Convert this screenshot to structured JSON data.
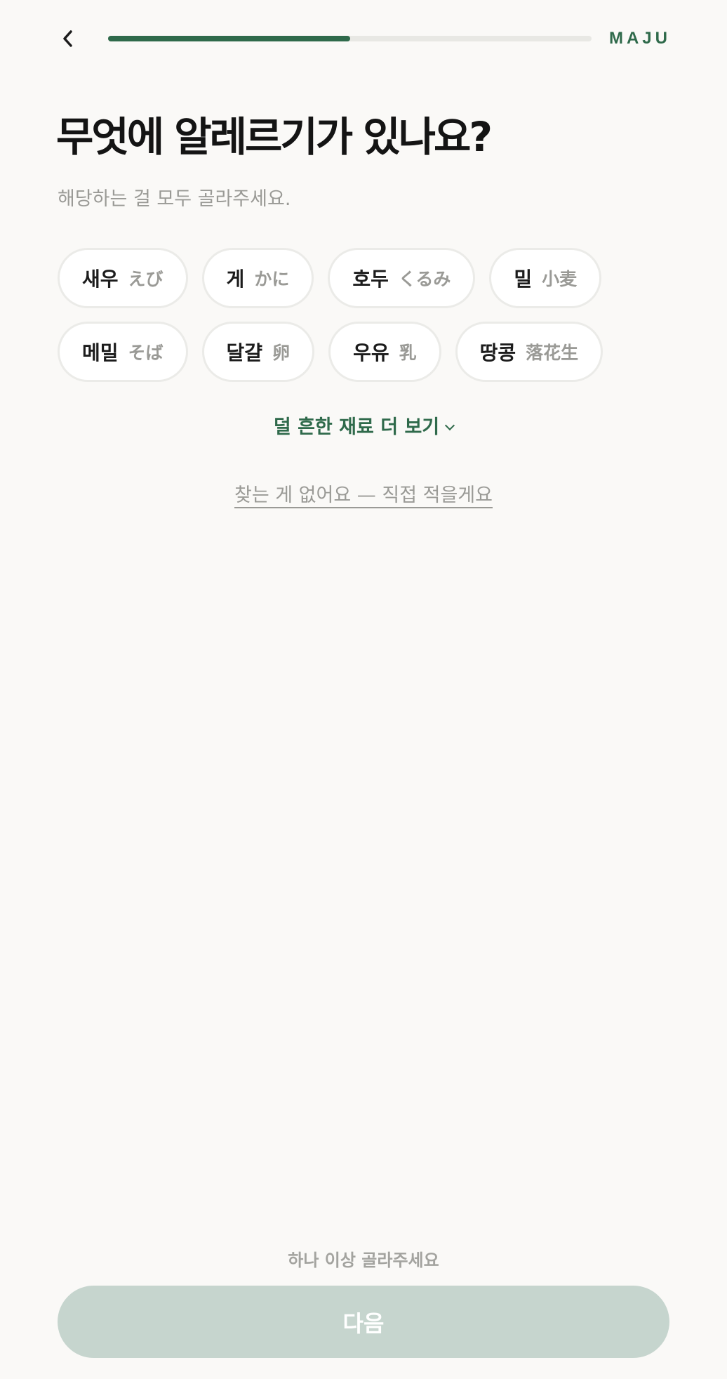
{
  "header": {
    "back_icon": "chevron-left-icon",
    "progress": 0.5,
    "progress_color": "#2f6a4b",
    "brand": "MAJU"
  },
  "question": {
    "title": "무엇에 알레르기가 있나요?",
    "subtitle": "해당하는 걸 모두 골라주세요."
  },
  "options": [
    [
      {
        "ko": "새우",
        "ja": "えび"
      },
      {
        "ko": "게",
        "ja": "かに"
      },
      {
        "ko": "호두",
        "ja": "くるみ"
      },
      {
        "ko": "밀",
        "ja": "小麦"
      }
    ],
    [
      {
        "ko": "메밀",
        "ja": "そば"
      },
      {
        "ko": "달걀",
        "ja": "卵"
      },
      {
        "ko": "우유",
        "ja": "乳"
      },
      {
        "ko": "땅콩",
        "ja": "落花生"
      }
    ]
  ],
  "more_label": "덜 흔한 재료 더 보기",
  "custom_label": "찾는 게 없어요 — 직접 적을게요",
  "footer": {
    "hint": "하나 이상 골라주세요",
    "next_label": "다음",
    "next_color": "#c6d5ce"
  }
}
